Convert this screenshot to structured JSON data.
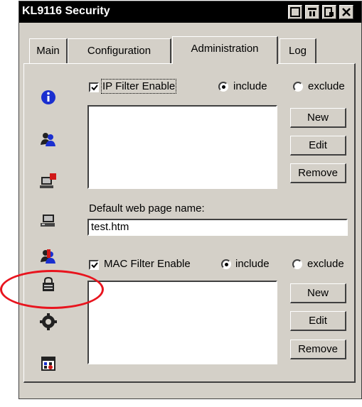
{
  "window": {
    "title": "KL9116 Security"
  },
  "tabs": [
    {
      "label": "Main"
    },
    {
      "label": "Configuration"
    },
    {
      "label": "Administration"
    },
    {
      "label": "Log"
    }
  ],
  "active_tab": "Administration",
  "ip_filter": {
    "label": "IP Filter Enable",
    "checked": true,
    "include_label": "include",
    "exclude_label": "exclude",
    "selected": "include",
    "new_label": "New",
    "edit_label": "Edit",
    "remove_label": "Remove"
  },
  "default_page": {
    "label": "Default web page name:",
    "value": "test.htm"
  },
  "mac_filter": {
    "label": "MAC Filter Enable",
    "checked": true,
    "include_label": "include",
    "exclude_label": "exclude",
    "selected": "include",
    "new_label": "New",
    "edit_label": "Edit",
    "remove_label": "Remove"
  },
  "sidebar_icons": [
    "info-icon",
    "users-icon",
    "computer-alert-icon",
    "computer-icon",
    "user-alert-icon",
    "lock-icon",
    "gear-icon",
    "calendar-icon"
  ],
  "colors": {
    "highlight": "#e8141e",
    "icon_blue": "#1a2fd0",
    "icon_red": "#d01818"
  }
}
